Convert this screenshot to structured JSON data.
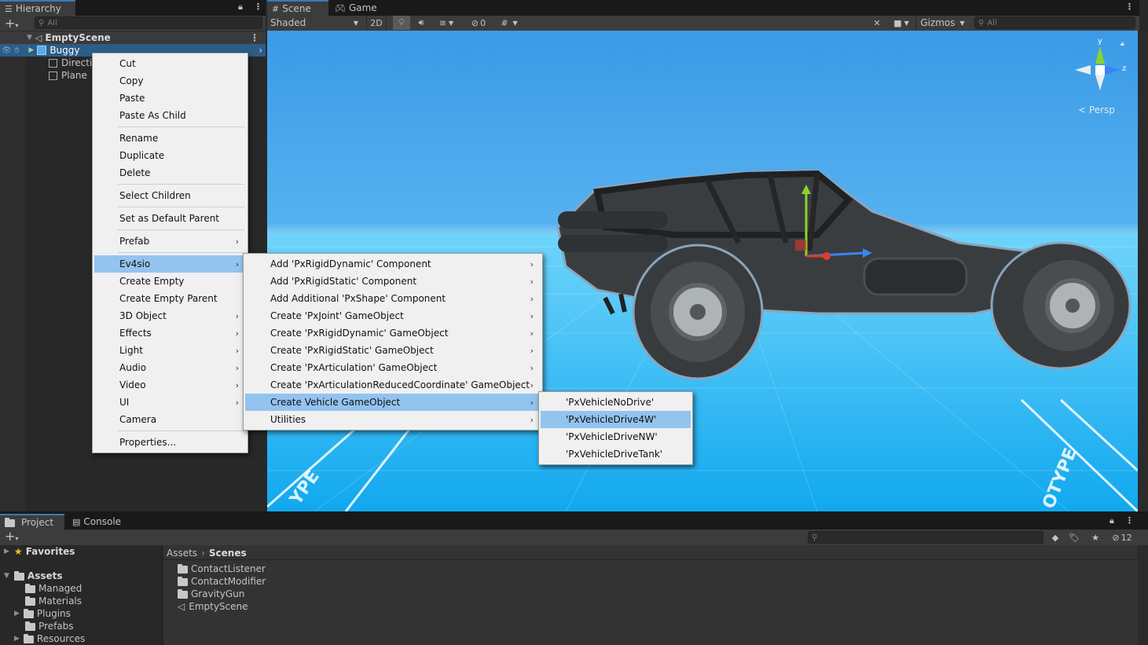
{
  "hierarchy": {
    "tab_label": "Hierarchy",
    "search_placeholder": "All",
    "scene_name": "EmptyScene",
    "items": [
      {
        "label": "Buggy",
        "selected": true
      },
      {
        "label": "Directio"
      },
      {
        "label": "Plane"
      }
    ]
  },
  "scene_view": {
    "tabs": [
      {
        "label": "Scene"
      },
      {
        "label": "Game"
      }
    ],
    "shading_mode": "Shaded",
    "toggle_2d": "2D",
    "hidden_count": "0",
    "gizmos_label": "Gizmos",
    "search_placeholder": "All",
    "projection_label": "Persp",
    "axis_labels": {
      "y": "y",
      "z": "z"
    },
    "sky_color": "#4aa8ee",
    "ground_color": "#1fb9f4"
  },
  "context_menu": {
    "groups": [
      [
        {
          "label": "Cut"
        },
        {
          "label": "Copy"
        },
        {
          "label": "Paste"
        },
        {
          "label": "Paste As Child"
        }
      ],
      [
        {
          "label": "Rename"
        },
        {
          "label": "Duplicate"
        },
        {
          "label": "Delete"
        }
      ],
      [
        {
          "label": "Select Children"
        }
      ],
      [
        {
          "label": "Set as Default Parent"
        }
      ],
      [
        {
          "label": "Prefab",
          "submenu": true
        }
      ],
      [
        {
          "label": "Ev4sio",
          "submenu": true,
          "highlighted": true
        },
        {
          "label": "Create Empty"
        },
        {
          "label": "Create Empty Parent"
        },
        {
          "label": "3D Object",
          "submenu": true
        },
        {
          "label": "Effects",
          "submenu": true
        },
        {
          "label": "Light",
          "submenu": true
        },
        {
          "label": "Audio",
          "submenu": true
        },
        {
          "label": "Video",
          "submenu": true
        },
        {
          "label": "UI",
          "submenu": true
        },
        {
          "label": "Camera"
        }
      ],
      [
        {
          "label": "Properties..."
        }
      ]
    ]
  },
  "ev4sio_menu": {
    "items": [
      {
        "label": "Add 'PxRigidDynamic' Component",
        "submenu": true
      },
      {
        "label": "Add 'PxRigidStatic' Component",
        "submenu": true
      },
      {
        "label": "Add Additional 'PxShape' Component",
        "submenu": true
      },
      {
        "label": "Create 'PxJoint' GameObject",
        "submenu": true
      },
      {
        "label": "Create 'PxRigidDynamic' GameObject",
        "submenu": true
      },
      {
        "label": "Create 'PxRigidStatic' GameObject",
        "submenu": true
      },
      {
        "label": "Create 'PxArticulation' GameObject",
        "submenu": true
      },
      {
        "label": "Create 'PxArticulationReducedCoordinate' GameObject",
        "submenu": true
      },
      {
        "label": "Create Vehicle GameObject",
        "submenu": true,
        "highlighted": true
      },
      {
        "label": "Utilities",
        "submenu": true
      }
    ]
  },
  "vehicle_menu": {
    "items": [
      {
        "label": "'PxVehicleNoDrive'"
      },
      {
        "label": "'PxVehicleDrive4W'",
        "highlighted": true
      },
      {
        "label": "'PxVehicleDriveNW'"
      },
      {
        "label": "'PxVehicleDriveTank'"
      }
    ]
  },
  "project": {
    "tabs": [
      {
        "label": "Project"
      },
      {
        "label": "Console"
      }
    ],
    "hidden_count": "12",
    "favorites_label": "Favorites",
    "assets_label": "Assets",
    "tree": [
      {
        "label": "Managed",
        "expandable": false
      },
      {
        "label": "Materials",
        "expandable": false
      },
      {
        "label": "Plugins",
        "expandable": true
      },
      {
        "label": "Prefabs",
        "expandable": false
      },
      {
        "label": "Resources",
        "expandable": true
      }
    ],
    "breadcrumb": [
      "Assets",
      "Scenes"
    ],
    "files": [
      {
        "label": "ContactListener",
        "kind": "folder"
      },
      {
        "label": "ContactModifier",
        "kind": "folder"
      },
      {
        "label": "GravityGun",
        "kind": "folder"
      },
      {
        "label": "EmptyScene",
        "kind": "scene"
      }
    ]
  }
}
